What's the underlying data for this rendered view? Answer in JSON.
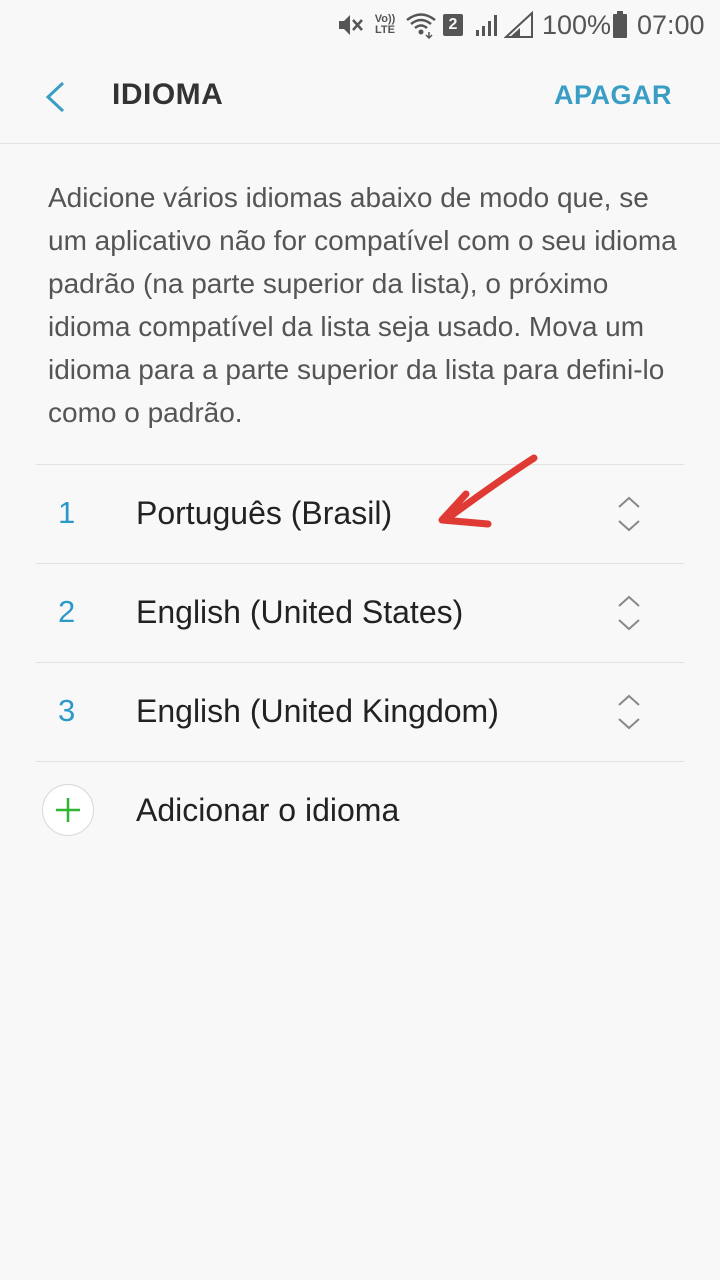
{
  "status_bar": {
    "volte_top": "Vo))",
    "volte_bottom": "LTE",
    "sim_number": "2",
    "battery_percent": "100%",
    "time": "07:00",
    "icons": [
      "mute-icon",
      "volte-icon",
      "wifi-icon",
      "sim-2-icon",
      "signal-icon",
      "signal-icon",
      "battery-icon"
    ]
  },
  "header": {
    "title": "IDIOMA",
    "action_label": "APAGAR"
  },
  "description": "Adicione vários idiomas abaixo de modo que, se um aplicativo não for compatível com o seu idioma padrão (na parte superior da lista), o próximo idioma compatível da lista seja usado. Mova um idioma para a parte superior da lista para defini-lo como o padrão.",
  "languages": [
    {
      "number": "1",
      "name": "Português (Brasil)"
    },
    {
      "number": "2",
      "name": "English (United States)"
    },
    {
      "number": "3",
      "name": "English (United Kingdom)"
    }
  ],
  "add_language_label": "Adicionar o idioma",
  "colors": {
    "accent": "#3a9ec4",
    "number": "#2b9ac8",
    "add_icon": "#2fb52f",
    "annotation": "#e03a35",
    "background": "#f8f8f8"
  }
}
